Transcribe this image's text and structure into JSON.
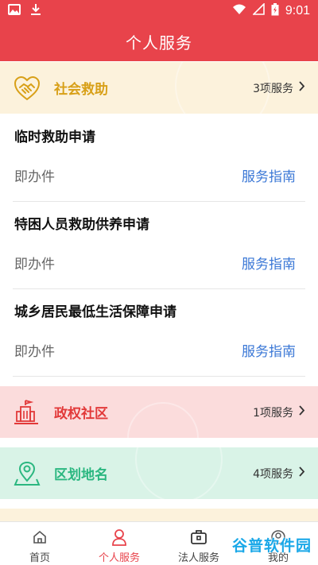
{
  "status_bar": {
    "time": "9:01",
    "icons": [
      "image-icon",
      "download-icon",
      "wifi-icon",
      "signal-icon",
      "battery-icon"
    ]
  },
  "app_bar": {
    "title": "个人服务"
  },
  "categories": [
    {
      "name": "社会救助",
      "count": "3项服务",
      "icon": "handshake-icon",
      "color": "#d8a018",
      "services": [
        {
          "title": "临时救助申请",
          "type": "即办件",
          "guide": "服务指南"
        },
        {
          "title": "特困人员救助供养申请",
          "type": "即办件",
          "guide": "服务指南"
        },
        {
          "title": "城乡居民最低生活保障申请",
          "type": "即办件",
          "guide": "服务指南"
        }
      ]
    },
    {
      "name": "政权社区",
      "count": "1项服务",
      "icon": "government-building-icon",
      "color": "#e23a3a"
    },
    {
      "name": "区划地名",
      "count": "4项服务",
      "icon": "location-pin-icon",
      "color": "#2bb780"
    }
  ],
  "bottom_nav": [
    {
      "label": "首页",
      "icon": "home-icon",
      "active": false
    },
    {
      "label": "个人服务",
      "icon": "person-icon",
      "active": true
    },
    {
      "label": "法人服务",
      "icon": "briefcase-icon",
      "active": false
    },
    {
      "label": "我的",
      "icon": "user-icon",
      "active": false
    }
  ],
  "watermark": {
    "text": "谷普软件园"
  },
  "colors": {
    "primary": "#e8434b",
    "link": "#3a77d6"
  }
}
